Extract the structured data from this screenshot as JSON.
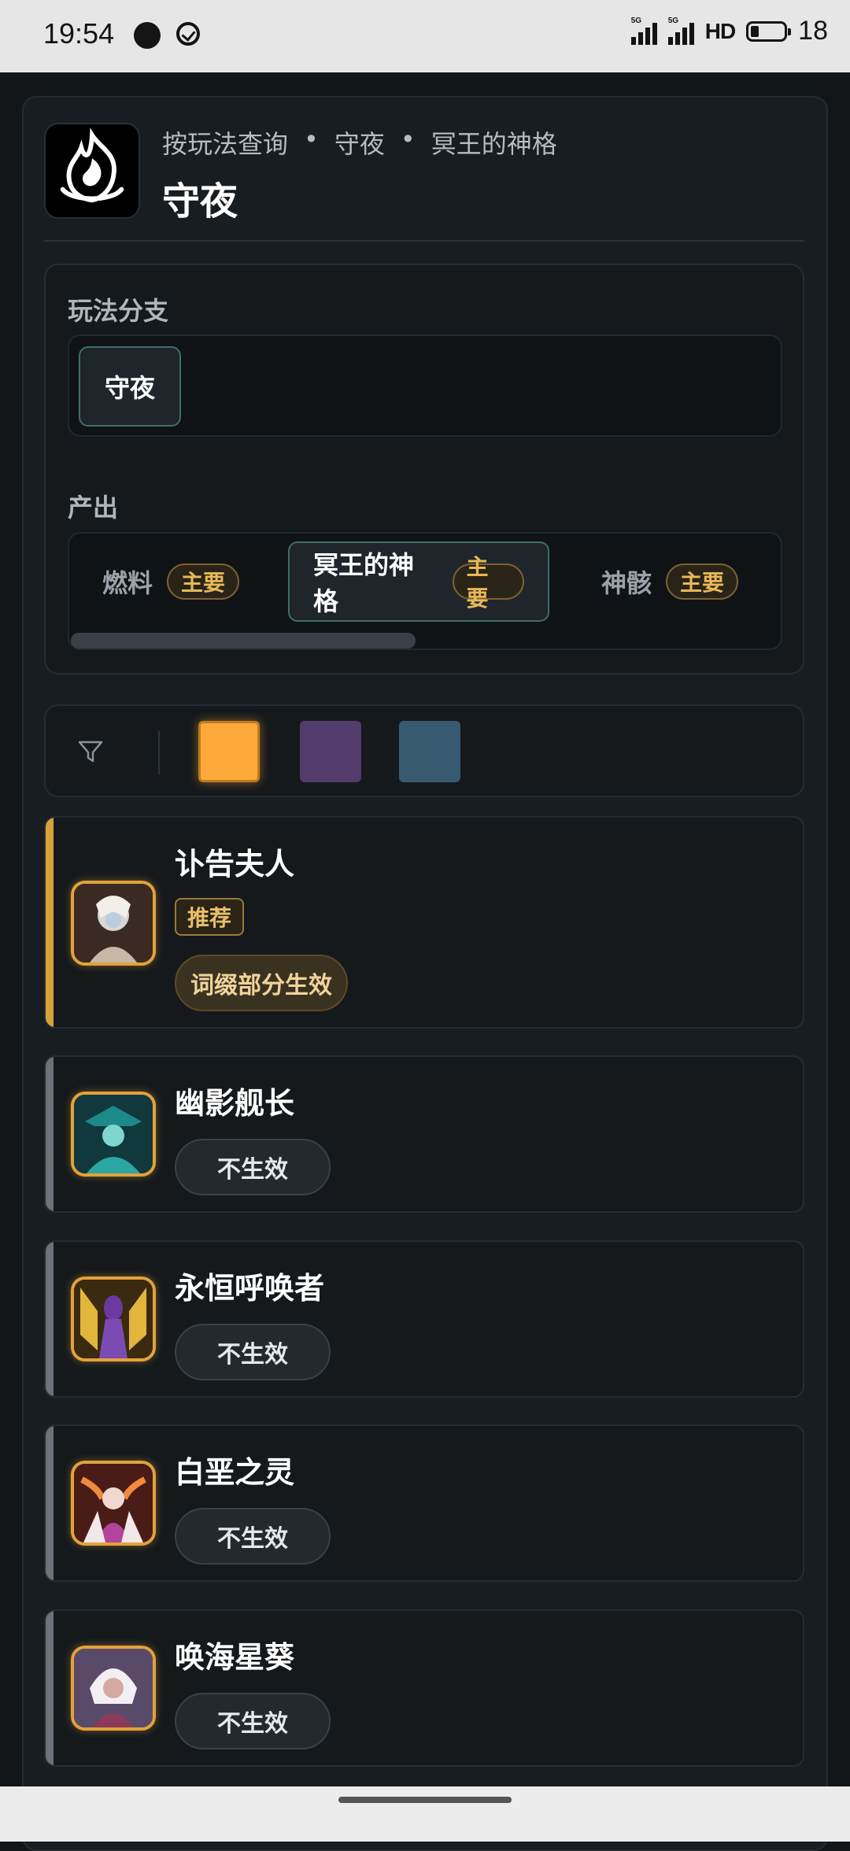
{
  "status_bar": {
    "time": "19:54",
    "network_1": "5G",
    "network_2": "5G",
    "hd_label": "HD",
    "battery_level": "18"
  },
  "header": {
    "breadcrumb": [
      "按玩法查询",
      "守夜",
      "冥王的神格"
    ],
    "title": "守夜",
    "logo_icon": "flame-emblem-icon"
  },
  "branch": {
    "label": "玩法分支",
    "chips": [
      "守夜"
    ],
    "selected": "守夜"
  },
  "output": {
    "label": "产出",
    "items": [
      {
        "name": "燃料",
        "badge": "主要"
      },
      {
        "name": "冥王的神格",
        "badge": "主要"
      },
      {
        "name": "神骸",
        "badge": "主要"
      }
    ],
    "selected": "冥王的神格"
  },
  "filter": {
    "icon": "filter-icon",
    "swatches": [
      "#ffa93a",
      "#533b6b",
      "#375a71"
    ],
    "selected_swatch": "#ffa93a"
  },
  "heroes": [
    {
      "name": "讣告夫人",
      "tag": "推荐",
      "status": "词缀部分生效",
      "accent": "#d8a33a"
    },
    {
      "name": "幽影舰长",
      "status": "不生效",
      "accent": "#6b7177"
    },
    {
      "name": "永恒呼唤者",
      "status": "不生效",
      "accent": "#6b7177"
    },
    {
      "name": "白垩之灵",
      "status": "不生效",
      "accent": "#6b7177"
    },
    {
      "name": "唤海星葵",
      "status": "不生效",
      "accent": "#6b7177"
    }
  ]
}
